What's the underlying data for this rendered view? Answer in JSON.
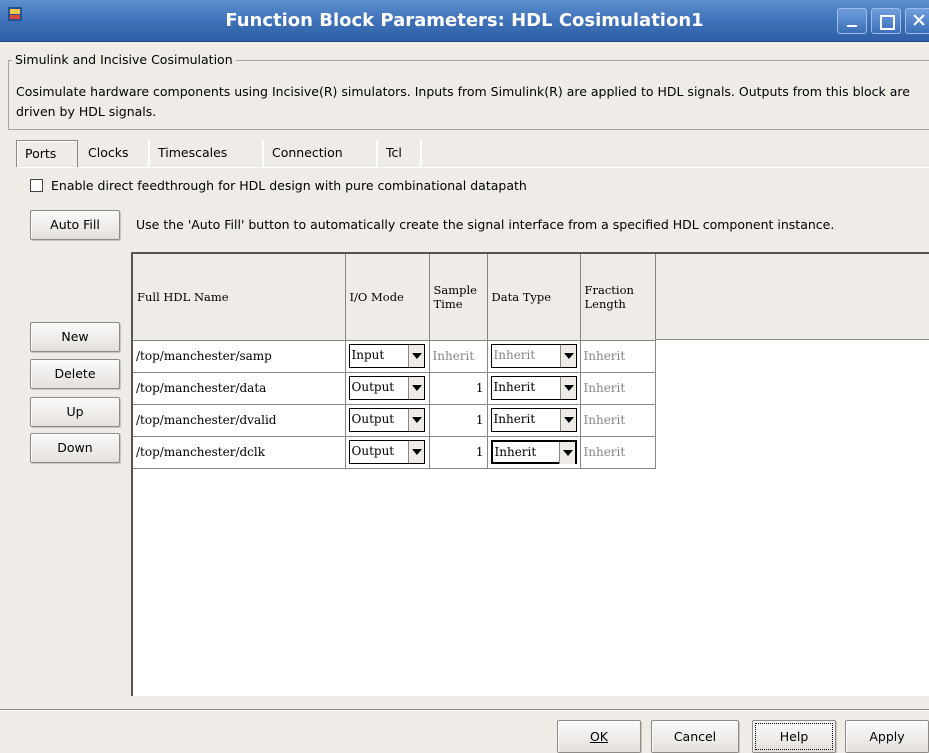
{
  "window": {
    "title": "Function Block Parameters: HDL Cosimulation1"
  },
  "group": {
    "label": "Simulink and Incisive Cosimulation",
    "description": "Cosimulate hardware components using Incisive(R) simulators.  Inputs from Simulink(R) are applied to HDL signals.  Outputs from this block are driven by HDL signals."
  },
  "tabs": [
    {
      "label": "Ports",
      "active": true
    },
    {
      "label": "Clocks",
      "active": false
    },
    {
      "label": "Timescales",
      "active": false
    },
    {
      "label": "Connection",
      "active": false
    },
    {
      "label": "Tcl",
      "active": false
    }
  ],
  "feedthrough": {
    "label": "Enable direct feedthrough for HDL design with pure combinational datapath",
    "checked": false
  },
  "autofill": {
    "button_label": "Auto Fill",
    "hint": "Use the 'Auto Fill' button to automatically create the signal interface from a specified HDL component instance."
  },
  "side_buttons": {
    "new": "New",
    "delete": "Delete",
    "up": "Up",
    "down": "Down"
  },
  "table": {
    "columns": [
      "Full HDL Name",
      "I/O Mode",
      "Sample Time",
      "Data Type",
      "Fraction Length"
    ],
    "rows": [
      {
        "name": "/top/manchester/samp",
        "io_mode": "Input",
        "sample_time": "Inherit",
        "data_type": "Inherit",
        "fraction_length": "Inherit"
      },
      {
        "name": "/top/manchester/data",
        "io_mode": "Output",
        "sample_time": "1",
        "data_type": "Inherit",
        "fraction_length": "Inherit"
      },
      {
        "name": "/top/manchester/dvalid",
        "io_mode": "Output",
        "sample_time": "1",
        "data_type": "Inherit",
        "fraction_length": "Inherit"
      },
      {
        "name": "/top/manchester/dclk",
        "io_mode": "Output",
        "sample_time": "1",
        "data_type": "Inherit",
        "fraction_length": "Inherit"
      }
    ]
  },
  "footer": {
    "ok": "OK",
    "cancel": "Cancel",
    "help": "Help",
    "apply": "Apply"
  },
  "colors": {
    "titlebar": "#3f72b8",
    "dialog_bg": "#efebe7"
  }
}
